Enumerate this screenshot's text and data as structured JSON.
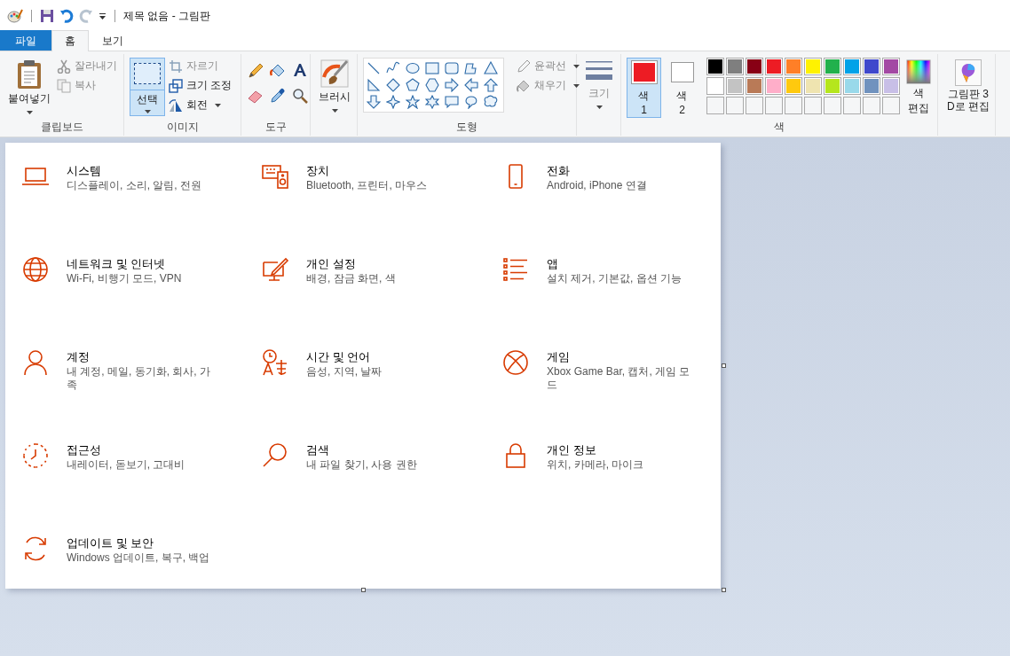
{
  "title_bar": {
    "title": "제목 없음 - 그림판"
  },
  "tabs": [
    {
      "label": "파일",
      "kind": "file",
      "selected": false
    },
    {
      "label": "홈",
      "kind": "tab",
      "selected": true
    },
    {
      "label": "보기",
      "kind": "tab",
      "selected": false
    }
  ],
  "ribbon": {
    "clipboard": {
      "label": "클립보드",
      "paste": "붙여넣기",
      "cut": {
        "label": "잘라내기",
        "disabled": true
      },
      "copy": {
        "label": "복사",
        "disabled": true
      }
    },
    "image": {
      "label": "이미지",
      "select": {
        "label": "선택",
        "selected": true
      },
      "crop": {
        "label": "자르기",
        "disabled": true
      },
      "resize": {
        "label": "크기 조정",
        "disabled": false
      },
      "rotate": {
        "label": "회전",
        "disabled": false
      }
    },
    "tools": {
      "label": "도구"
    },
    "brushes": {
      "label": "브러시"
    },
    "shapes": {
      "label": "도형",
      "outline": {
        "label": "윤곽선",
        "disabled": true
      },
      "fill": {
        "label": "채우기",
        "disabled": true
      }
    },
    "size": {
      "label": "크기",
      "disabled": true
    },
    "colors": {
      "label": "색",
      "color1": {
        "label": "색 1",
        "color": "#ed1c24",
        "selected": true
      },
      "color2": {
        "label": "색 2",
        "color": "#ffffff",
        "selected": false
      },
      "palette": [
        {
          "color": "#000000"
        },
        {
          "color": "#7f7f7f"
        },
        {
          "color": "#880015"
        },
        {
          "color": "#ed1c24"
        },
        {
          "color": "#ff7f27"
        },
        {
          "color": "#fff200"
        },
        {
          "color": "#22b14c"
        },
        {
          "color": "#00a2e8"
        },
        {
          "color": "#3f48cc"
        },
        {
          "color": "#a349a4"
        },
        {
          "color": "#ffffff"
        },
        {
          "color": "#c3c3c3"
        },
        {
          "color": "#b97a57"
        },
        {
          "color": "#ffaec9"
        },
        {
          "color": "#ffc90e"
        },
        {
          "color": "#efe4b0"
        },
        {
          "color": "#b5e61d"
        },
        {
          "color": "#99d9ea"
        },
        {
          "color": "#7092be"
        },
        {
          "color": "#c8bfe7"
        }
      ],
      "edit_colors": "색 편집"
    },
    "paint3d": {
      "label": "그림판 3D로 편집"
    }
  },
  "canvas": {
    "settings": [
      {
        "title": "시스템",
        "subtitle": "디스플레이, 소리, 알림, 전원"
      },
      {
        "title": "장치",
        "subtitle": "Bluetooth, 프린터, 마우스"
      },
      {
        "title": "전화",
        "subtitle": "Android, iPhone 연결"
      },
      {
        "title": "네트워크 및 인터넷",
        "subtitle": "Wi-Fi, 비행기 모드, VPN"
      },
      {
        "title": "개인 설정",
        "subtitle": "배경, 잠금 화면, 색"
      },
      {
        "title": "앱",
        "subtitle": "설치 제거, 기본값, 옵션 기능"
      },
      {
        "title": "계정",
        "subtitle": "내 계정, 메일, 동기화, 회사, 가족"
      },
      {
        "title": "시간 및 언어",
        "subtitle": "음성, 지역, 날짜"
      },
      {
        "title": "게임",
        "subtitle": "Xbox Game Bar, 캡처, 게임 모드"
      },
      {
        "title": "접근성",
        "subtitle": "내레이터, 돋보기, 고대비"
      },
      {
        "title": "검색",
        "subtitle": "내 파일 찾기, 사용 권한"
      },
      {
        "title": "개인 정보",
        "subtitle": "위치, 카메라, 마이크"
      },
      {
        "title": "업데이트 및 보안",
        "subtitle": "Windows 업데이트, 복구, 백업"
      }
    ]
  }
}
